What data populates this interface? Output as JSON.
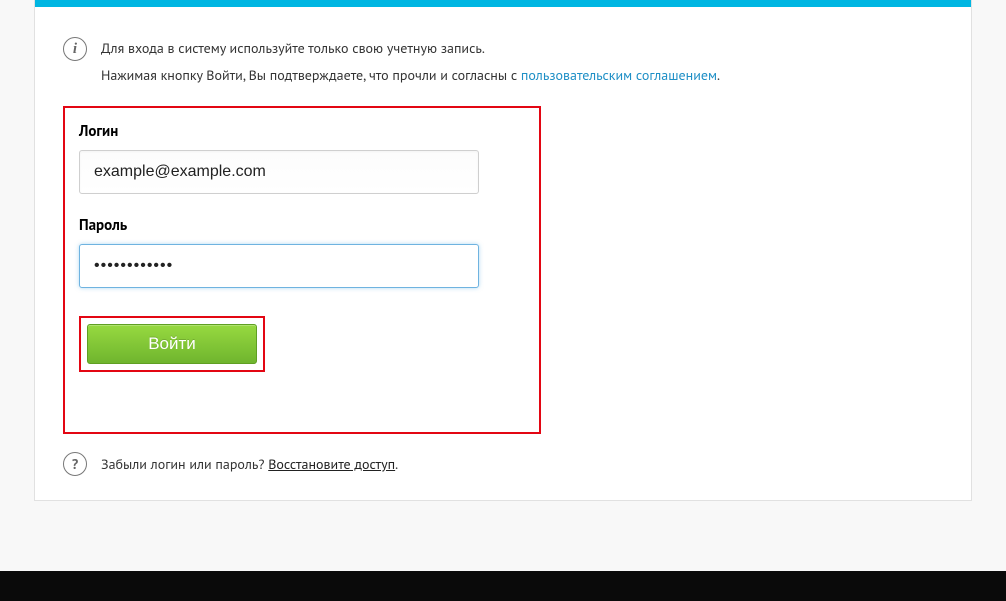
{
  "info": {
    "line1": "Для входа в систему используйте только свою учетную запись.",
    "line2_prefix": "Нажимая кнопку Войти, Вы подтверждаете, что прочли и согласны с ",
    "agreement_link_text": "пользовательским соглашением",
    "line2_suffix": "."
  },
  "form": {
    "login_label": "Логин",
    "login_value": "example@example.com",
    "password_label": "Пароль",
    "password_value": "••••••••••••",
    "submit_label": "Войти"
  },
  "help": {
    "text_prefix": "Забыли логин или пароль? ",
    "recover_link_text": "Восстановите доступ",
    "text_suffix": "."
  }
}
